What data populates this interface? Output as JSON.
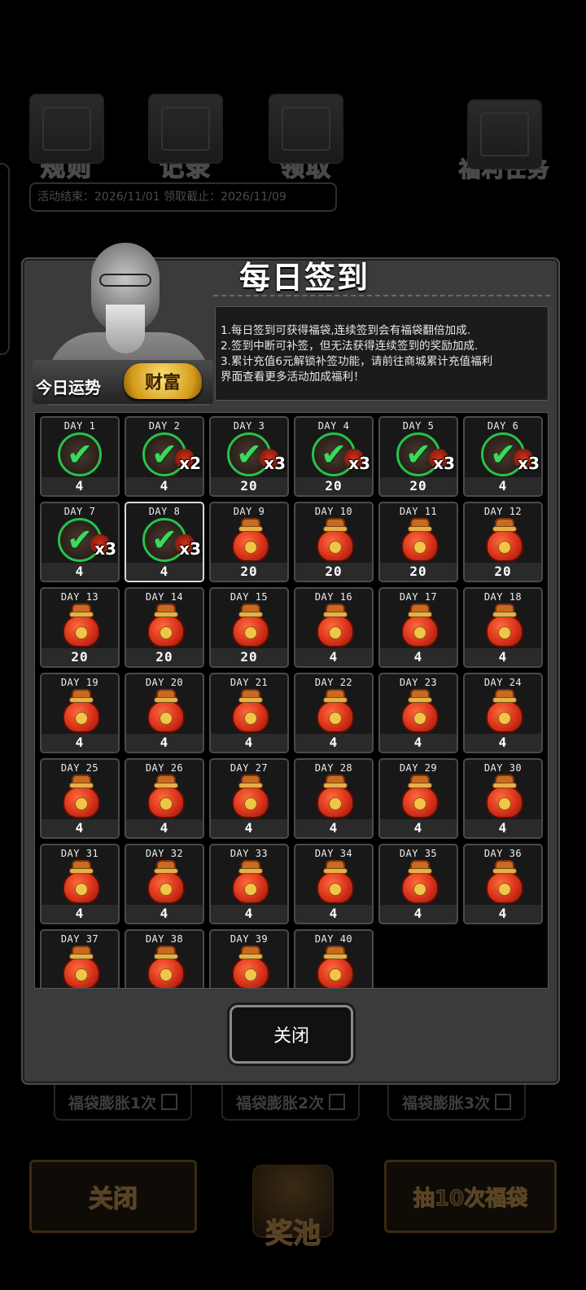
{
  "background": {
    "top_icons": [
      {
        "label": "规则",
        "icon": "rulebook-icon"
      },
      {
        "label": "记录",
        "icon": "scroll-quill-icon"
      },
      {
        "label": "领取",
        "icon": "receive-box-icon"
      },
      {
        "label": "福利任务",
        "icon": "target-task-icon"
      }
    ],
    "date_bar": "活动结束：2026/11/01  领取截止：2026/11/09",
    "expand_rows": [
      "福袋膨胀1次",
      "福袋膨胀2次",
      "福袋膨胀3次"
    ],
    "bottom_close": "关闭",
    "prize_pool": "奖池",
    "draw_ten": "抽10次福袋"
  },
  "modal": {
    "title": "每日签到",
    "fortune_label": "今日运势",
    "fortune_badge": "财富",
    "rules": [
      "1.每日签到可获得福袋,连续签到会有福袋翻倍加成.",
      "2.签到中断可补签，但无法获得连续签到的奖励加成.",
      "3.累计充值6元解锁补签功能，请前往商城累计充值福利",
      "界面查看更多活动加成福利！"
    ],
    "days": [
      {
        "day": "DAY 1",
        "amount": "4",
        "signed": true,
        "multiplier": ""
      },
      {
        "day": "DAY 2",
        "amount": "4",
        "signed": true,
        "multiplier": "x2"
      },
      {
        "day": "DAY 3",
        "amount": "20",
        "signed": true,
        "multiplier": "x3"
      },
      {
        "day": "DAY 4",
        "amount": "20",
        "signed": true,
        "multiplier": "x3"
      },
      {
        "day": "DAY 5",
        "amount": "20",
        "signed": true,
        "multiplier": "x3"
      },
      {
        "day": "DAY 6",
        "amount": "4",
        "signed": true,
        "multiplier": "x3"
      },
      {
        "day": "DAY 7",
        "amount": "4",
        "signed": true,
        "multiplier": "x3"
      },
      {
        "day": "DAY 8",
        "amount": "4",
        "signed": true,
        "multiplier": "x3",
        "current": true
      },
      {
        "day": "DAY 9",
        "amount": "20",
        "signed": false
      },
      {
        "day": "DAY 10",
        "amount": "20",
        "signed": false
      },
      {
        "day": "DAY 11",
        "amount": "20",
        "signed": false
      },
      {
        "day": "DAY 12",
        "amount": "20",
        "signed": false
      },
      {
        "day": "DAY 13",
        "amount": "20",
        "signed": false
      },
      {
        "day": "DAY 14",
        "amount": "20",
        "signed": false
      },
      {
        "day": "DAY 15",
        "amount": "20",
        "signed": false
      },
      {
        "day": "DAY 16",
        "amount": "4",
        "signed": false
      },
      {
        "day": "DAY 17",
        "amount": "4",
        "signed": false
      },
      {
        "day": "DAY 18",
        "amount": "4",
        "signed": false
      },
      {
        "day": "DAY 19",
        "amount": "4",
        "signed": false
      },
      {
        "day": "DAY 20",
        "amount": "4",
        "signed": false
      },
      {
        "day": "DAY 21",
        "amount": "4",
        "signed": false
      },
      {
        "day": "DAY 22",
        "amount": "4",
        "signed": false
      },
      {
        "day": "DAY 23",
        "amount": "4",
        "signed": false
      },
      {
        "day": "DAY 24",
        "amount": "4",
        "signed": false
      },
      {
        "day": "DAY 25",
        "amount": "4",
        "signed": false
      },
      {
        "day": "DAY 26",
        "amount": "4",
        "signed": false
      },
      {
        "day": "DAY 27",
        "amount": "4",
        "signed": false
      },
      {
        "day": "DAY 28",
        "amount": "4",
        "signed": false
      },
      {
        "day": "DAY 29",
        "amount": "4",
        "signed": false
      },
      {
        "day": "DAY 30",
        "amount": "4",
        "signed": false
      },
      {
        "day": "DAY 31",
        "amount": "4",
        "signed": false
      },
      {
        "day": "DAY 32",
        "amount": "4",
        "signed": false
      },
      {
        "day": "DAY 33",
        "amount": "4",
        "signed": false
      },
      {
        "day": "DAY 34",
        "amount": "4",
        "signed": false
      },
      {
        "day": "DAY 35",
        "amount": "4",
        "signed": false
      },
      {
        "day": "DAY 36",
        "amount": "4",
        "signed": false
      },
      {
        "day": "DAY 37",
        "amount": "",
        "signed": false
      },
      {
        "day": "DAY 38",
        "amount": "",
        "signed": false
      },
      {
        "day": "DAY 39",
        "amount": "",
        "signed": false
      },
      {
        "day": "DAY 40",
        "amount": "",
        "signed": false
      }
    ],
    "close_label": "关闭"
  },
  "colors": {
    "check_green": "#3ed85c",
    "bag_red": "#d8321a",
    "modal_bg": "#3b3b3b"
  }
}
